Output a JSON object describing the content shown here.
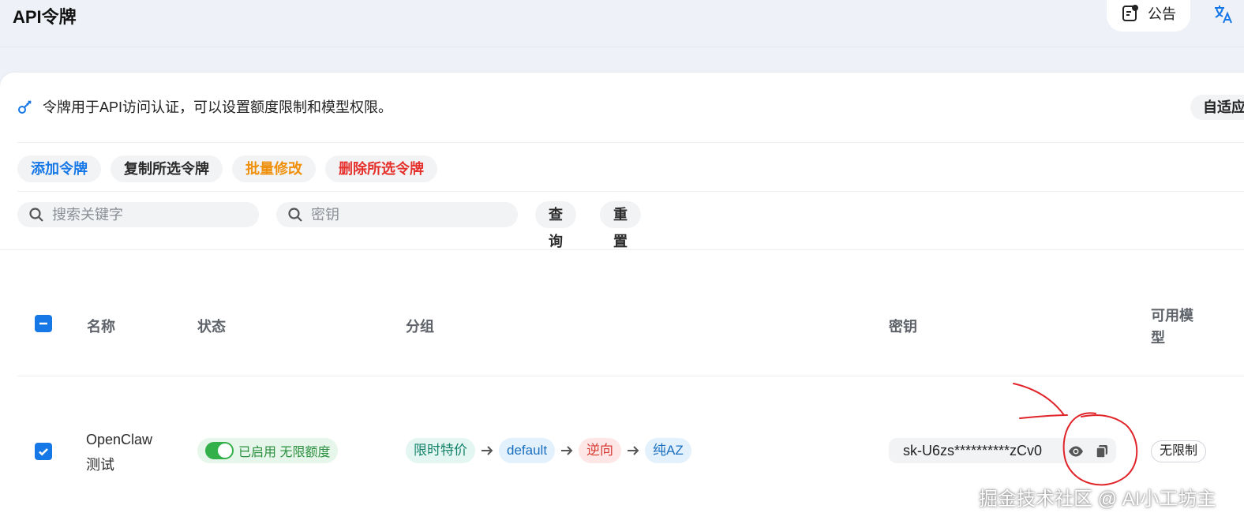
{
  "header": {
    "title": "API令牌",
    "notice_label": "公告",
    "language_icon": "translate-icon"
  },
  "info": {
    "text": "令牌用于API访问认证，可以设置额度限制和模型权限。",
    "icon": "key-icon",
    "adapt_label": "自适应"
  },
  "actions": {
    "add": "添加令牌",
    "copy_selected": "复制所选令牌",
    "batch_edit": "批量修改",
    "delete_selected": "删除所选令牌"
  },
  "search": {
    "keyword_placeholder": "搜索关键字",
    "key_placeholder": "密钥",
    "query_label": "查询",
    "reset_label": "重置"
  },
  "table": {
    "columns": [
      "名称",
      "状态",
      "分组",
      "密钥",
      "可用模",
      "型"
    ],
    "rows": [
      {
        "name_line1": "OpenClaw",
        "name_line2": "测试",
        "status": "已启用 无限额度",
        "enabled": true,
        "groups": [
          "限时特价",
          "default",
          "逆向",
          "纯AZ"
        ],
        "key": "sk-U6zs**********zCv0",
        "models": "无限制"
      }
    ]
  },
  "colors": {
    "accent": "#1677e6",
    "enabled_green": "#34b04a",
    "annotation_red": "#e0242a"
  },
  "watermark": "掘金技术社区 @ AI小工坊主"
}
